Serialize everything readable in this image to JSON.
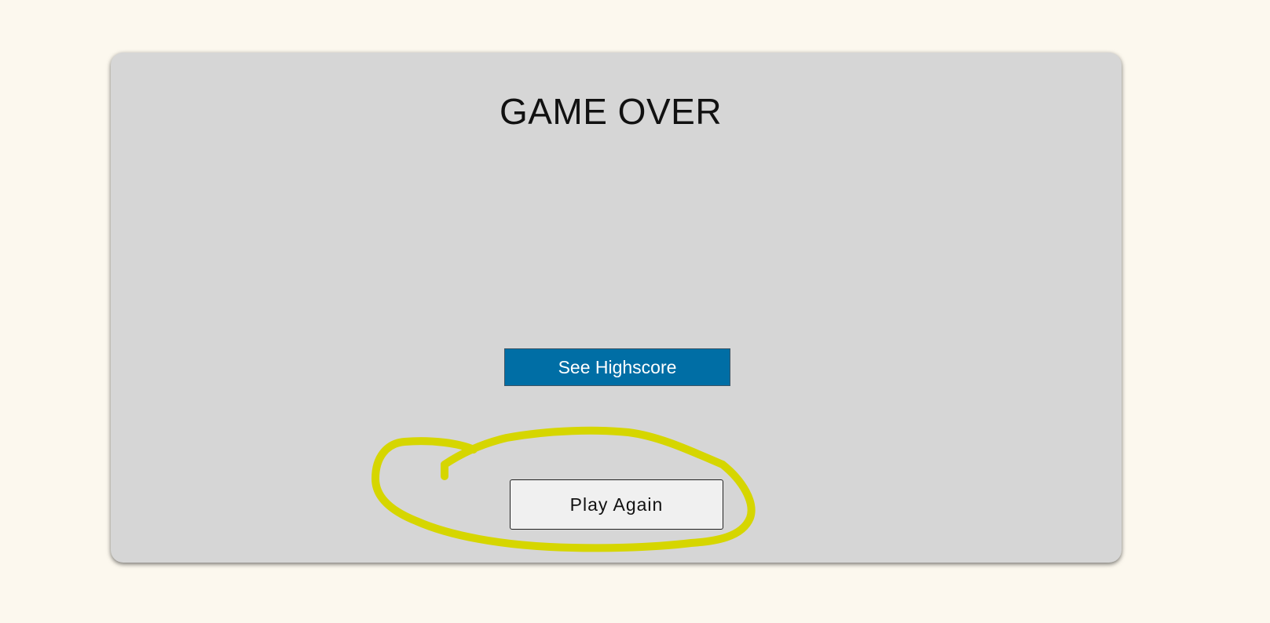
{
  "screen": {
    "title": "GAME OVER"
  },
  "buttons": {
    "highscore_label": "See Highscore",
    "play_again_label": "Play Again"
  },
  "colors": {
    "page_background": "#fcf8ee",
    "card_background": "#d6d6d6",
    "highscore_button": "#006ea5",
    "play_again_button": "#f0f0f0",
    "annotation_highlight": "#d6d600"
  }
}
